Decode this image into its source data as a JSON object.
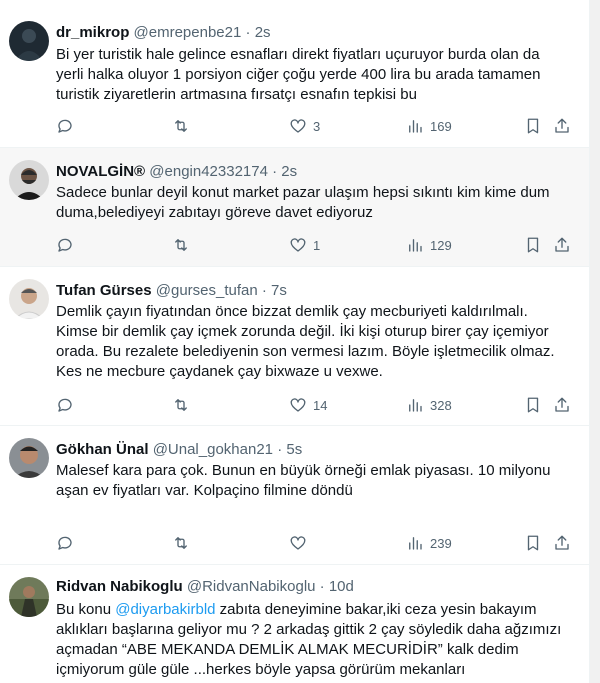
{
  "colors": {
    "accent": "#1d9bf0",
    "muted": "#536471",
    "text": "#0f1419",
    "highlight_bg": "#f7f7f7"
  },
  "tweets": [
    {
      "name": "dr_mikrop",
      "handle": "@emrepenbe21",
      "time": "2s",
      "lines": [
        "Bi yer turistik hale gelince esnafları direkt fiyatları uçuruyor burda olan da",
        "yerli halka oluyor 1 porsiyon ciğer çoğu yerde 400 lira bu arada tamamen",
        "turistik ziyaretlerin artmasına fırsatçı esnafın tepkisi bu"
      ],
      "likes": "3",
      "views": "169"
    },
    {
      "name": "NOVALGİN®",
      "handle": "@engin42332174",
      "time": "2s",
      "lines": [
        "Sadece bunlar deyil konut market pazar ulaşım hepsi sıkıntı kim kime dum",
        "duma,belediyeyi zabıtayı göreve davet ediyoruz"
      ],
      "likes": "1",
      "views": "129"
    },
    {
      "name": "Tufan Gürses",
      "handle": "@gurses_tufan",
      "time": "7s",
      "lines": [
        "Demlik çayın fiyatından önce bizzat demlik çay mecburiyeti kaldırılmalı.",
        "Kimse bir demlik çay içmek zorunda değil. İki kişi oturup birer çay içemiyor",
        "orada. Bu rezalete belediyenin son vermesi lazım. Böyle işletmecilik olmaz.",
        "Kes ne mecbure çaydanek çay bixwaze u vexwe."
      ],
      "likes": "14",
      "views": "328"
    },
    {
      "name": "Gökhan Ünal",
      "handle": "@Unal_gokhan21",
      "time": "5s",
      "lines": [
        "Malesef kara para çok. Bunun en büyük örneği emlak piyasası. 10 milyonu",
        "aşan ev fiyatları var. Kolpaçino filmine döndü"
      ],
      "likes": "",
      "views": "239"
    },
    {
      "name": "Ridvan Nabikoglu",
      "handle": "@RidvanNabikoglu",
      "time": "10d",
      "line1_pre": "Bu konu ",
      "line1_mention": "@diyarbakirbld",
      "line1_post": " zabıta deneyimine bakar,iki ceza yesin bakayım",
      "lines": [
        "aklıkları başlarına geliyor mu ? 2 arkadaş gittik 2 çay söyledik daha ağzımızı",
        "açmadan “ABE MEKANDA DEMLİK ALMAK MECURİDİR” kalk dedim",
        "içmiyorum güle güle ...herkes böyle yapsa görürüm mekanları"
      ]
    }
  ],
  "separator": "·"
}
